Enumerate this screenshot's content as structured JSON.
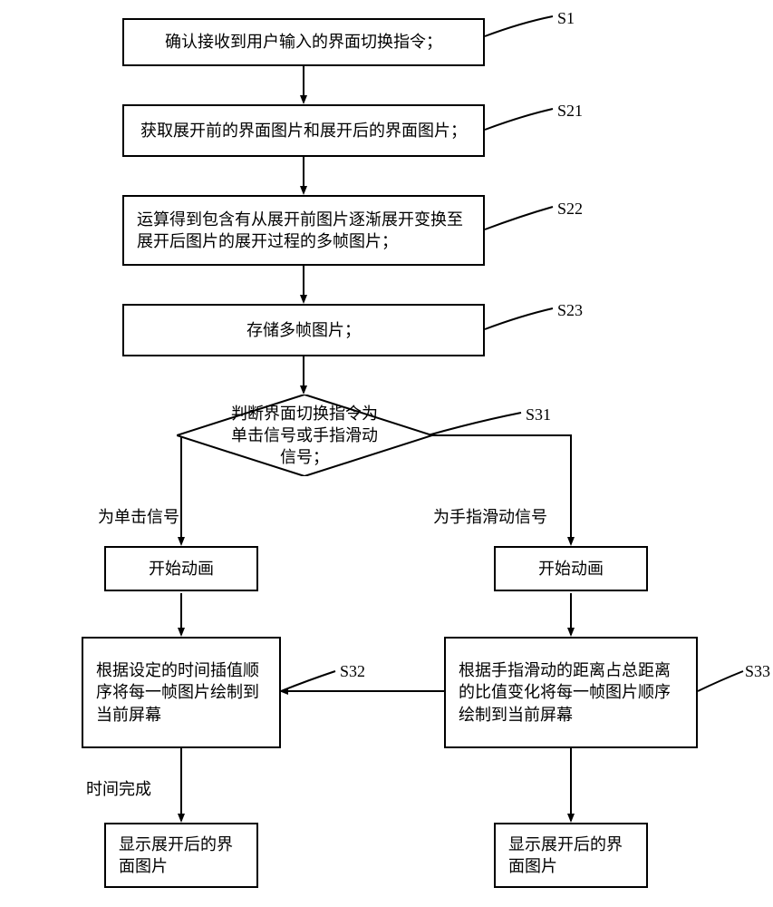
{
  "steps": {
    "s1": "确认接收到用户输入的界面切换指令；",
    "s21": "获取展开前的界面图片和展开后的界面图片；",
    "s22": "运算得到包含有从展开前图片逐渐展开变换至展开后图片的展开过程的多帧图片；",
    "s23": "存储多帧图片；",
    "s31_decision": "判断界面切换指令为单击信号或手指滑动信号；",
    "left_start": "开始动画",
    "right_start": "开始动画",
    "s32": "根据设定的时间插值顺序将每一帧图片绘制到当前屏幕",
    "s33": "根据手指滑动的距离占总距离的比值变化将每一帧图片顺序绘制到当前屏幕",
    "left_final": "显示展开后的界面图片",
    "right_final": "显示展开后的界面图片"
  },
  "labels": {
    "s1": "S1",
    "s21": "S21",
    "s22": "S22",
    "s23": "S23",
    "s31": "S31",
    "s32": "S32",
    "s33": "S33",
    "branch_left": "为单击信号",
    "branch_right": "为手指滑动信号",
    "time_done": "时间完成"
  }
}
